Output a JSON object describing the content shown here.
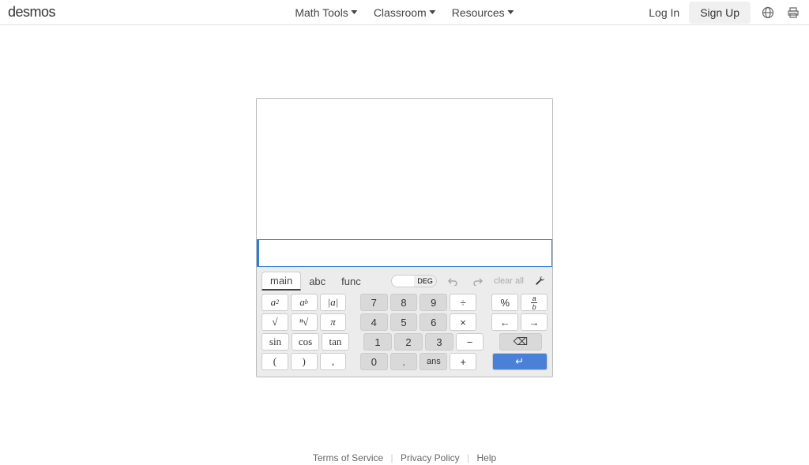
{
  "header": {
    "logo": "desmos",
    "nav": {
      "math_tools": "Math Tools",
      "classroom": "Classroom",
      "resources": "Resources"
    },
    "login": "Log In",
    "signup": "Sign Up"
  },
  "tabs": {
    "main": "main",
    "abc": "abc",
    "func": "func"
  },
  "mode": {
    "rad": "",
    "deg": "DEG"
  },
  "toolbar": {
    "clear_all": "clear all"
  },
  "keys": {
    "sq": "a",
    "sq_sup": "2",
    "pow": "a",
    "pow_sup": "b",
    "abs": "|a|",
    "sqrt": "√",
    "nroot": "ⁿ√",
    "pi": "π",
    "sin": "sin",
    "cos": "cos",
    "tan": "tan",
    "lparen": "(",
    "rparen": ")",
    "comma": ",",
    "n7": "7",
    "n8": "8",
    "n9": "9",
    "n4": "4",
    "n5": "5",
    "n6": "6",
    "n1": "1",
    "n2": "2",
    "n3": "3",
    "n0": "0",
    "dot": ".",
    "ans": "ans",
    "div": "÷",
    "mul": "×",
    "sub": "−",
    "add": "+",
    "pct": "%",
    "frac_a": "a",
    "frac_b": "b",
    "left": "←",
    "right": "→",
    "back": "⌫",
    "enter": "↵"
  },
  "footer": {
    "terms": "Terms of Service",
    "privacy": "Privacy Policy",
    "help": "Help"
  }
}
